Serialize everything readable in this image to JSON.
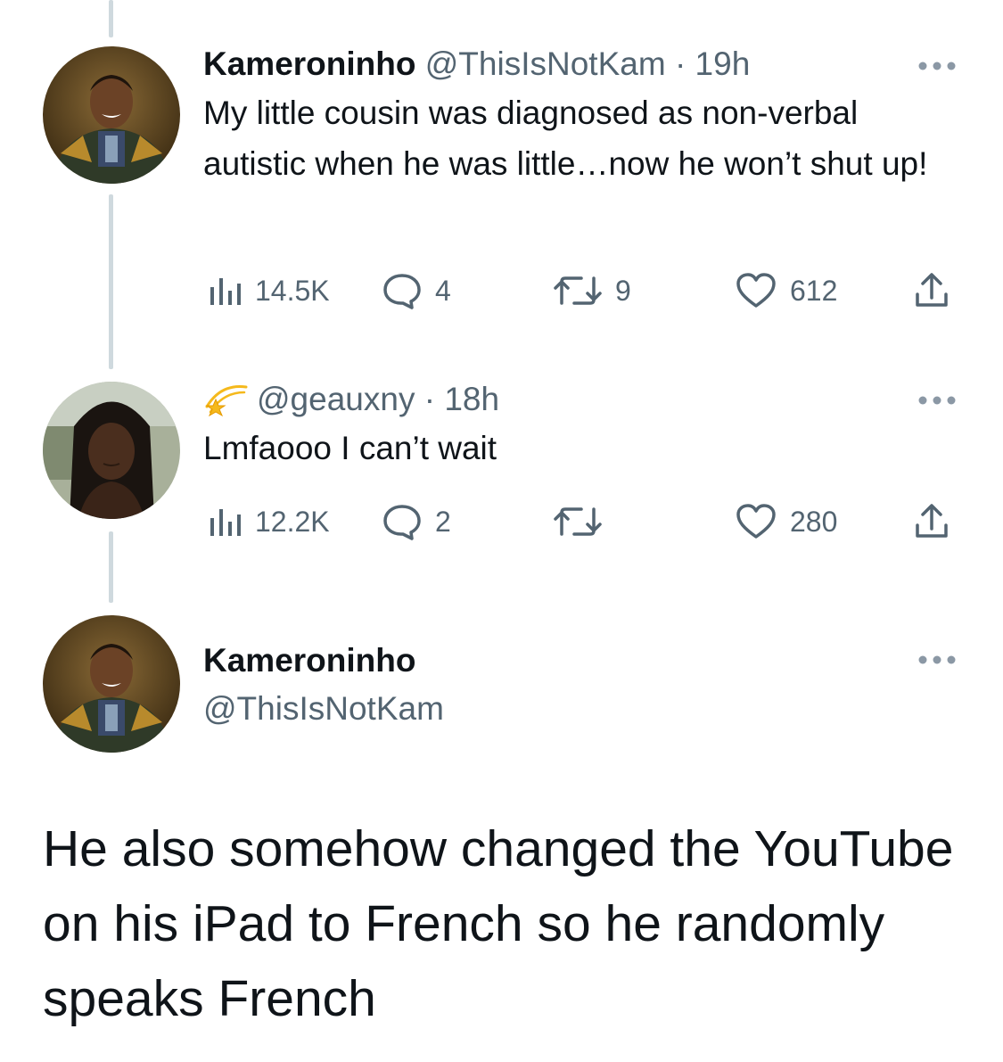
{
  "tweet1": {
    "name": "Kameroninho",
    "handle": "@ThisIsNotKam",
    "separator": "·",
    "time": "19h",
    "text": "My little cousin was diagnosed as non-verbal autistic when he was little…now he won’t shut up!",
    "views": "14.5K",
    "replies": "4",
    "retweets": "9",
    "likes": "612"
  },
  "tweet2": {
    "handle": "@geauxny",
    "separator": "·",
    "time": "18h",
    "text": "Lmfaooo I can’t wait",
    "views": "12.2K",
    "replies": "2",
    "retweets": "",
    "likes": "280"
  },
  "main_tweet": {
    "name": "Kameroninho",
    "handle": "@ThisIsNotKam",
    "text": "He also somehow changed the YouTube on his iPad to French so he randomly speaks French"
  },
  "icons": {
    "views": "bar-chart-icon",
    "reply": "speech-bubble-icon",
    "retweet": "retweet-icon",
    "like": "heart-icon",
    "share": "share-icon",
    "more": "more-dots-icon",
    "badge": "dizzy-star-emoji"
  },
  "colors": {
    "text": "#0f1419",
    "muted": "#536471",
    "thread_line": "#cfd9de",
    "background": "#ffffff"
  }
}
